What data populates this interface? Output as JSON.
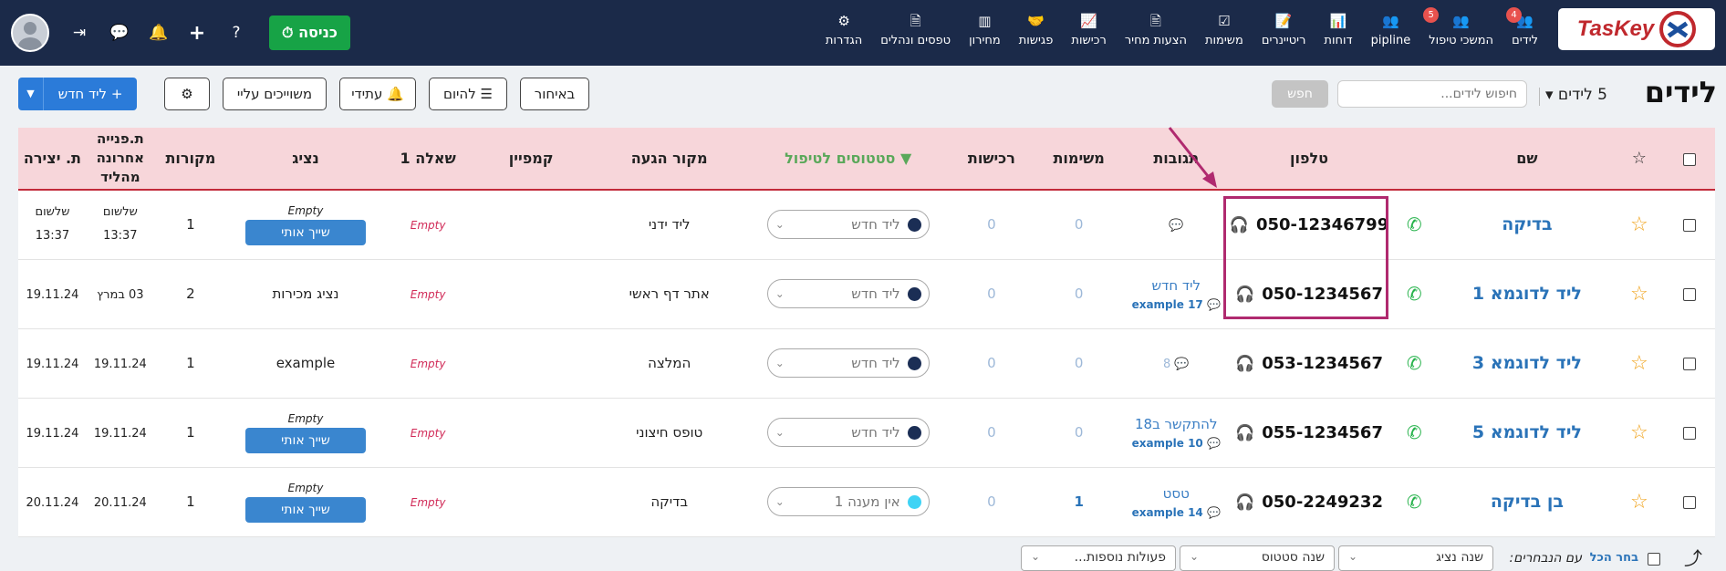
{
  "topbar": {
    "logo_text": "TasKey",
    "nav": [
      {
        "icon": "👥",
        "icon_name": "leads-icon",
        "label": "לידים",
        "badge": "4"
      },
      {
        "icon": "👥",
        "icon_name": "assignees-icon",
        "label": "המשכי טיפול",
        "badge": "5"
      },
      {
        "icon": "👥",
        "icon_name": "pipeline-icon",
        "label": "pipline",
        "badge": ""
      },
      {
        "icon": "📊",
        "icon_name": "reports-icon",
        "label": "דוחות",
        "badge": ""
      },
      {
        "icon": "📝",
        "icon_name": "retainers-icon",
        "label": "ריטיינרים",
        "badge": ""
      },
      {
        "icon": "☑",
        "icon_name": "tasks-icon",
        "label": "משימות",
        "badge": ""
      },
      {
        "icon": "🖹",
        "icon_name": "quotes-icon",
        "label": "הצעות מחיר",
        "badge": ""
      },
      {
        "icon": "📈",
        "icon_name": "purchases-icon",
        "label": "רכישות",
        "badge": ""
      },
      {
        "icon": "🤝",
        "icon_name": "meetings-icon",
        "label": "פגישות",
        "badge": ""
      },
      {
        "icon": "▥",
        "icon_name": "barcode-icon",
        "label": "מחירון",
        "badge": ""
      },
      {
        "icon": "🗎",
        "icon_name": "forms-icon",
        "label": "טפסים ונהלים",
        "badge": ""
      },
      {
        "icon": "⚙",
        "icon_name": "settings-icon",
        "label": "הגדרות",
        "badge": ""
      }
    ],
    "enter_label": "כניסה",
    "enter_icon": "⏱"
  },
  "subbar": {
    "title": "לידים",
    "count": "5 לידים ▾",
    "search_placeholder": "חיפוש לידים...",
    "search_button": "חפש",
    "filters": [
      "באיחור",
      "להיום",
      "עתידי",
      "משוייכים עליי"
    ],
    "new_lead": "לידחדש",
    "new_lead_label": "+ ליד חדש"
  },
  "table": {
    "headers": {
      "name": "שם",
      "phone": "טלפון",
      "responses": "תגובות",
      "tasks": "משימות",
      "purchases": "רכישות",
      "status": "סטטוסים לטיפול",
      "source": "מקור הגעה",
      "campaign": "קמפיין",
      "question": "שאלה 1",
      "agent": "נציג",
      "sources": "מקורות",
      "last_contact": "ת.פנייה אחרונה מהליד",
      "created": "ת. יצירה"
    },
    "rows": [
      {
        "name": "בדיקה",
        "phone": "050-12346799",
        "tag": "",
        "tag_sub": "",
        "comments": "",
        "tasks": "0",
        "purchases": "0",
        "status": "ליד חדש",
        "status_color": "#1b2e55",
        "source": "ליד ידני",
        "campaign": "",
        "question": "Empty",
        "agent": "Empty",
        "agent_assign": "שייך אותי",
        "sources": "1",
        "last": "שלשום 13:37",
        "created": "שלשום 13:37"
      },
      {
        "name": "ליד לדוגמא 1",
        "phone": "050-1234567",
        "tag": "ליד חדש",
        "tag_sub": "example 17",
        "comments": "",
        "tasks": "0",
        "purchases": "0",
        "status": "ליד חדש",
        "status_color": "#1b2e55",
        "source": "אתר דף ראשי",
        "campaign": "",
        "question": "Empty",
        "agent": "נציג מכירות",
        "agent_assign": "",
        "sources": "2",
        "last": "03 במרץ",
        "created": "19.11.24"
      },
      {
        "name": "ליד לדוגמא 3",
        "phone": "053-1234567",
        "tag": "",
        "tag_sub": "",
        "comments": "8",
        "tasks": "0",
        "purchases": "0",
        "status": "ליד חדש",
        "status_color": "#1b2e55",
        "source": "המלצה",
        "campaign": "",
        "question": "Empty",
        "agent": "example",
        "agent_assign": "",
        "sources": "1",
        "last": "19.11.24",
        "created": "19.11.24"
      },
      {
        "name": "ליד לדוגמא 5",
        "phone": "055-1234567",
        "tag": "להתקשר ב18",
        "tag_sub": "example 10",
        "comments": "",
        "tasks": "0",
        "purchases": "0",
        "status": "ליד חדש",
        "status_color": "#1b2e55",
        "source": "טופס חיצוני",
        "campaign": "",
        "question": "Empty",
        "agent": "Empty",
        "agent_assign": "שייך אותי",
        "sources": "1",
        "last": "19.11.24",
        "created": "19.11.24"
      },
      {
        "name": "בן בדיקה",
        "phone": "050-2249232",
        "tag": "טסט",
        "tag_sub": "example 14",
        "comments": "",
        "tasks": "1",
        "purchases": "0",
        "status": "אין מענה 1",
        "status_color": "#3fd3f5",
        "source": "בדיקה",
        "campaign": "",
        "question": "Empty",
        "agent": "Empty",
        "agent_assign": "שייך אותי",
        "sources": "1",
        "last": "20.11.24",
        "created": "20.11.24"
      }
    ]
  },
  "footer": {
    "select_all": "בחר הכל",
    "with_selected": "עם הנבחרים:",
    "change_agent": "שנה נציג",
    "change_status": "שנה סטטוס",
    "more_actions": "פעולות נוספות..."
  }
}
